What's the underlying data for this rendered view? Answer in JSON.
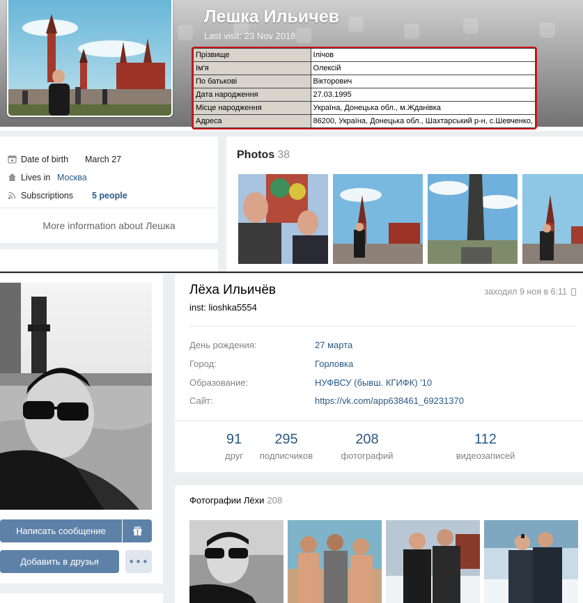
{
  "top": {
    "name": "Лешка Ильичев",
    "last_visit": "Last visit: 23 Nov 2018",
    "registry": [
      {
        "key": "Прізвище",
        "value": "Ілічов"
      },
      {
        "key": "Ім'я",
        "value": "Олексій"
      },
      {
        "key": "По батькові",
        "value": "Вікторович"
      },
      {
        "key": "Дата народження",
        "value": "27.03.1995"
      },
      {
        "key": "Місце народження",
        "value": "Україна, Донецька обл., м.Жданівка"
      },
      {
        "key": "Адреса",
        "value": "86200, Україна, Донецька обл., Шахтарський р-н, с.Шевченко,"
      }
    ],
    "info": {
      "dob_label": "Date of birth",
      "dob_value": "March 27",
      "lives_label": "Lives in",
      "lives_value": "Москва",
      "subs_label": "Subscriptions",
      "subs_value": "5 people",
      "more_info": "More information about Лешка"
    },
    "photos": {
      "title": "Photos",
      "count": "38"
    },
    "colors": {
      "highlight_border": "#c9161b",
      "link": "#2a5885"
    }
  },
  "bottom": {
    "name": "Лёха Ильичёв",
    "status": "inst: lioshka5554",
    "online": "заходил 9 ноя в 6:11",
    "rows": [
      {
        "key": "День рождения:",
        "value": "27 марта"
      },
      {
        "key": "Город:",
        "value": "Горловка"
      },
      {
        "key": "Образование:",
        "value": "НУФВСУ (бывш. КГИФК) '10"
      },
      {
        "key": "Сайт:",
        "value": "https://vk.com/app638461_69231370"
      }
    ],
    "counters": [
      {
        "num": "91",
        "label": "друг"
      },
      {
        "num": "295",
        "label": "подписчиков"
      },
      {
        "num": "208",
        "label": "фотографий"
      },
      {
        "num": "112",
        "label": "видеозаписей"
      }
    ],
    "buttons": {
      "message": "Написать сообщение",
      "add_friend": "Добавить в друзья"
    },
    "photos": {
      "title": "Фотографии Лёхи",
      "count": "208"
    },
    "colors": {
      "button": "#5e81a8",
      "link": "#2a5885"
    }
  }
}
